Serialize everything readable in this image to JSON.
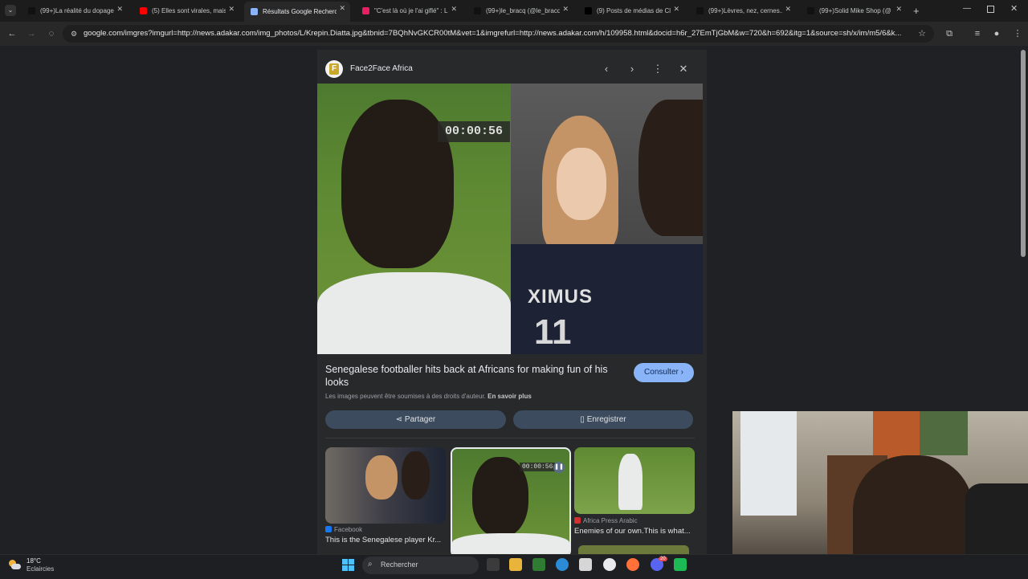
{
  "browser": {
    "tabs": [
      {
        "title": "(99+)La réalité du dopage",
        "favicon": "tiktok",
        "color": "#111111",
        "active": false
      },
      {
        "title": "(5) Elles sont virales, mais",
        "favicon": "youtube",
        "color": "#ff0000",
        "active": false
      },
      {
        "title": "Résultats Google Recherch",
        "favicon": "google-lens",
        "color": "#8ab4f8",
        "active": true
      },
      {
        "title": "\"C'est là où je l'ai giflé\" : L",
        "favicon": "news",
        "color": "#e91e63",
        "active": false
      },
      {
        "title": "(99+)le_bracq (@le_bracq",
        "favicon": "tiktok",
        "color": "#111111",
        "active": false
      },
      {
        "title": "(9) Posts de médias de Cl",
        "favicon": "x",
        "color": "#000000",
        "active": false
      },
      {
        "title": "(99+)Lèvres, nez, cernes...",
        "favicon": "tiktok",
        "color": "#111111",
        "active": false
      },
      {
        "title": "(99+)Solid Mike Shop (@",
        "favicon": "tiktok",
        "color": "#111111",
        "active": false
      }
    ],
    "url": "google.com/imgres?imgurl=http://news.adakar.com/img_photos/L/Krepin.Diatta.jpg&tbnid=7BQhNvGKCR00tM&vet=1&imgrefurl=http://news.adakar.com/h/109958.html&docid=h6r_27EmTjGbM&w=720&h=692&itg=1&source=sh/x/im/m5/6&k..."
  },
  "viewer": {
    "source_name": "Face2Face Africa",
    "source_logo_letter": "F",
    "timer_overlay": "00:00:56",
    "jersey_text": "XIMUS",
    "jersey_number": "11",
    "title": "Senegalese footballer hits back at Africans for making fun of his looks",
    "consult_label": "Consulter",
    "rights_text": "Les images peuvent être soumises à des droits d'auteur.",
    "rights_link": "En savoir plus",
    "share_label": "Partager",
    "save_label": "Enregistrer"
  },
  "related": [
    {
      "source": "Facebook",
      "source_color": "#1877f2",
      "caption": "This is the Senegalese player Kr..."
    },
    {
      "source": "",
      "source_color": "",
      "caption": "",
      "timer": "00:00:56"
    },
    {
      "source": "Africa Press Arabic",
      "source_color": "#d32f2f",
      "caption": "Enemies of our own.This is what..."
    }
  ],
  "taskbar": {
    "temperature": "18°C",
    "condition": "Eclaircies",
    "search_placeholder": "Rechercher",
    "notification_badge": "20"
  }
}
